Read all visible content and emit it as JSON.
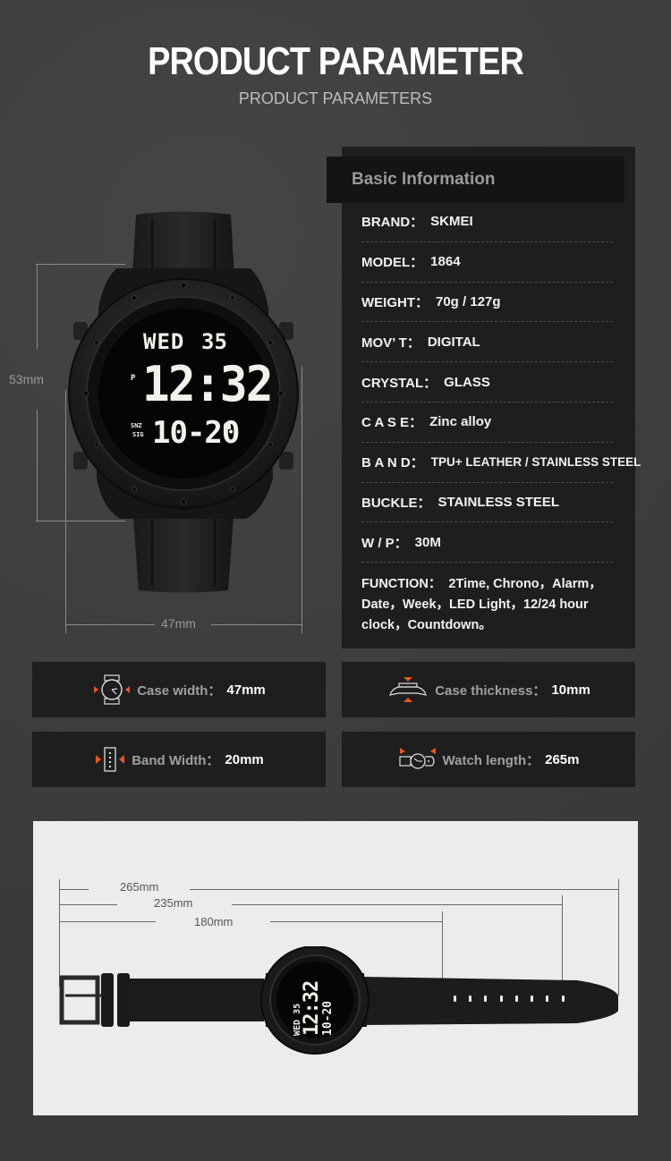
{
  "header": {
    "title": "PRODUCT PARAMETER",
    "subtitle": "PRODUCT PARAMETERS"
  },
  "front_image": {
    "height_label": "53mm",
    "width_label": "47mm",
    "display": {
      "day": "WED",
      "seconds": "35",
      "pm_indicator": "P",
      "time": "12:32",
      "date": "10-20",
      "snz_label": "SNZ",
      "sig_label": "SIG",
      "icon": "alarm-bell-icon"
    }
  },
  "basic_info": {
    "heading": "Basic Information",
    "rows": [
      {
        "label": "BRAND：",
        "value": "SKMEI"
      },
      {
        "label": "MODEL：",
        "value": "1864"
      },
      {
        "label": "WEIGHT：",
        "value": "70g / 127g"
      },
      {
        "label": "MOV’ T：",
        "value": "DIGITAL"
      },
      {
        "label": "CRYSTAL：",
        "value": "GLASS"
      },
      {
        "label": "C A S E：",
        "value": "Zinc alloy"
      },
      {
        "label": "B A N D：",
        "value": "TPU+ LEATHER / STAINLESS STEEL"
      },
      {
        "label": "BUCKLE：",
        "value": "STAINLESS STEEL"
      },
      {
        "label": "W / P：",
        "value": "30M"
      }
    ],
    "function": {
      "label": "FUNCTION：",
      "value": "2Time, Chrono，Alarm，Date，Week，LED Light，12/24 hour clock，Countdown。"
    }
  },
  "spec_cards": [
    {
      "icon": "case-width-icon",
      "label": "Case width：",
      "value": "47mm"
    },
    {
      "icon": "case-thickness-icon",
      "label": "Case thickness：",
      "value": "10mm"
    },
    {
      "icon": "band-width-icon",
      "label": "Band Width：",
      "value": "20mm"
    },
    {
      "icon": "watch-length-icon",
      "label": "Watch length：",
      "value": "265m"
    }
  ],
  "length_image": {
    "labels": [
      "265mm",
      "235mm",
      "180mm"
    ],
    "display": {
      "day": "WED",
      "seconds": "35",
      "time": "12:32",
      "date": "10-20"
    }
  },
  "colors": {
    "background": "#3d3d3d",
    "panel": "#1e1e1e",
    "accent_orange": "#e8561e",
    "bottom_panel": "#ececec"
  }
}
